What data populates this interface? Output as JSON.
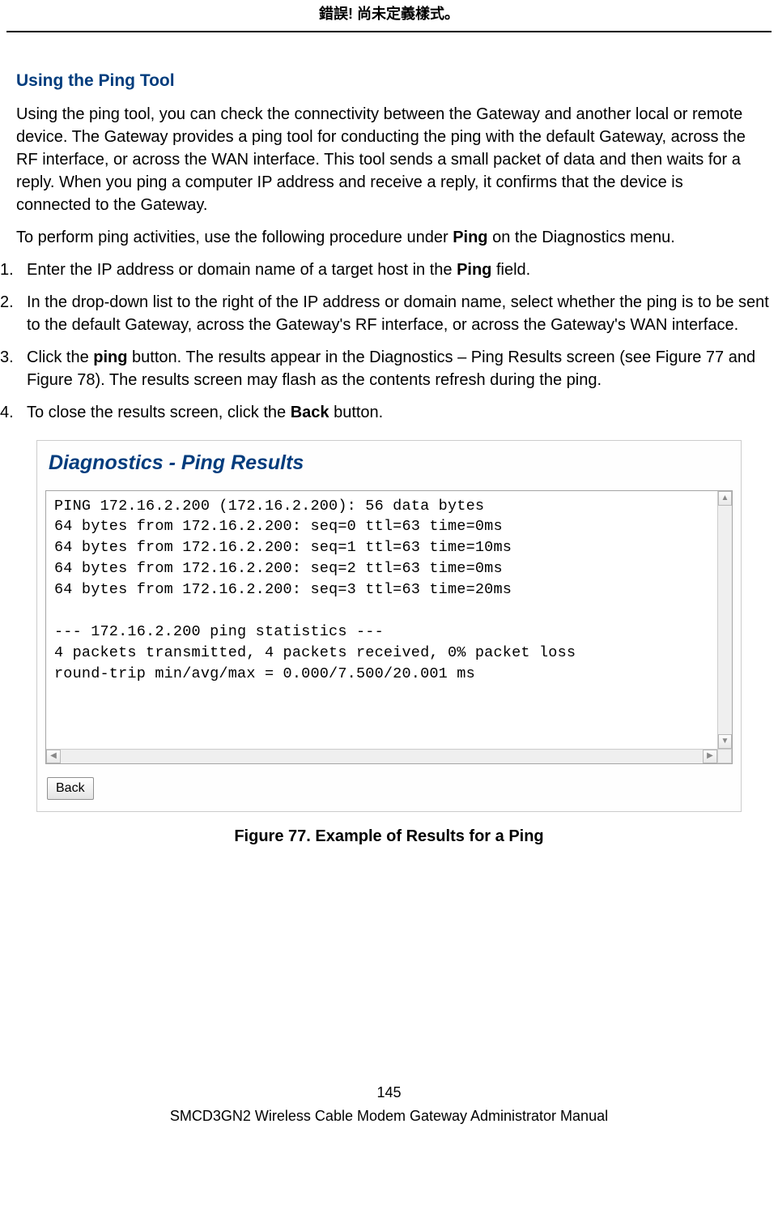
{
  "header": {
    "error_text": "錯誤! 尚未定義樣式。"
  },
  "section": {
    "title": "Using the Ping Tool",
    "para1": "Using the ping tool, you can check the connectivity between the Gateway and another local or remote device. The Gateway provides a ping tool for conducting the ping with the default Gateway, across the RF interface, or across the WAN interface. This tool sends a small packet of data and then waits for a reply. When you ping a computer IP address and receive a reply, it confirms that the device is connected to the Gateway.",
    "para2_prefix": "To perform ping activities, use the following procedure under ",
    "para2_bold": "Ping",
    "para2_suffix": " on the Diagnostics menu."
  },
  "steps": {
    "s1_a": "Enter the IP address or domain name of a target host in the ",
    "s1_b": "Ping",
    "s1_c": " field.",
    "s2": "In the drop-down list to the right of the IP address or domain name, select whether the ping is to be sent to the default Gateway, across the Gateway's RF interface, or across the Gateway's WAN interface.",
    "s3_a": "Click the ",
    "s3_b": "ping",
    "s3_c": " button. The results appear in the Diagnostics – Ping Results screen (see Figure 77 and Figure 78). The results screen may flash as the contents refresh during the ping.",
    "s4_a": "To close the results screen, click the ",
    "s4_b": "Back",
    "s4_c": " button."
  },
  "figure": {
    "panel_title": "Diagnostics - Ping Results",
    "results": "PING 172.16.2.200 (172.16.2.200): 56 data bytes\n64 bytes from 172.16.2.200: seq=0 ttl=63 time=0ms\n64 bytes from 172.16.2.200: seq=1 ttl=63 time=10ms\n64 bytes from 172.16.2.200: seq=2 ttl=63 time=0ms\n64 bytes from 172.16.2.200: seq=3 ttl=63 time=20ms\n\n--- 172.16.2.200 ping statistics ---\n4 packets transmitted, 4 packets received, 0% packet loss\nround-trip min/avg/max = 0.000/7.500/20.001 ms",
    "back_button": "Back",
    "caption": "Figure 77. Example of Results for a Ping"
  },
  "footer": {
    "page_number": "145",
    "manual_title": "SMCD3GN2 Wireless Cable Modem Gateway Administrator Manual"
  }
}
